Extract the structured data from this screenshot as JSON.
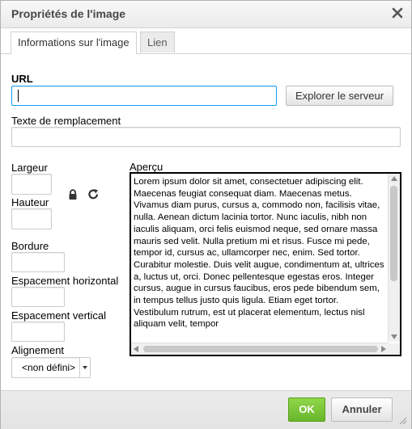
{
  "dialog": {
    "title": "Propriétés de l'image",
    "close_icon": "close-icon"
  },
  "tabs": [
    {
      "label": "Informations sur l'image",
      "active": true
    },
    {
      "label": "Lien",
      "active": false
    }
  ],
  "form": {
    "url_label": "URL",
    "url_value": "",
    "browse_button": "Explorer le serveur",
    "alt_label": "Texte de remplacement",
    "alt_value": "",
    "width_label": "Largeur",
    "width_value": "",
    "height_label": "Hauteur",
    "height_value": "",
    "lock_icon": "lock-icon",
    "reset_icon": "reset-size-icon",
    "border_label": "Bordure",
    "border_value": "",
    "hspace_label": "Espacement horizontal",
    "hspace_value": "",
    "vspace_label": "Espacement vertical",
    "vspace_value": "",
    "align_label": "Alignement",
    "align_value": "<non défini>"
  },
  "preview": {
    "label": "Aperçu",
    "text": "Lorem ipsum dolor sit amet, consectetuer adipiscing elit. Maecenas feugiat consequat diam. Maecenas metus. Vivamus diam purus, cursus a, commodo non, facilisis vitae, nulla. Aenean dictum lacinia tortor. Nunc iaculis, nibh non iaculis aliquam, orci felis euismod neque, sed ornare massa mauris sed velit. Nulla pretium mi et risus. Fusce mi pede, tempor id, cursus ac, ullamcorper nec, enim. Sed tortor. Curabitur molestie. Duis velit augue, condimentum at, ultrices a, luctus ut, orci. Donec pellentesque egestas eros. Integer cursus, augue in cursus faucibus, eros pede bibendum sem, in tempus tellus justo quis ligula. Etiam eget tortor. Vestibulum rutrum, est ut placerat elementum, lectus nisl aliquam velit, tempor"
  },
  "footer": {
    "ok_label": "OK",
    "cancel_label": "Annuler"
  },
  "colors": {
    "ok_button": "#7ac142",
    "focus_border": "#139ff7"
  }
}
